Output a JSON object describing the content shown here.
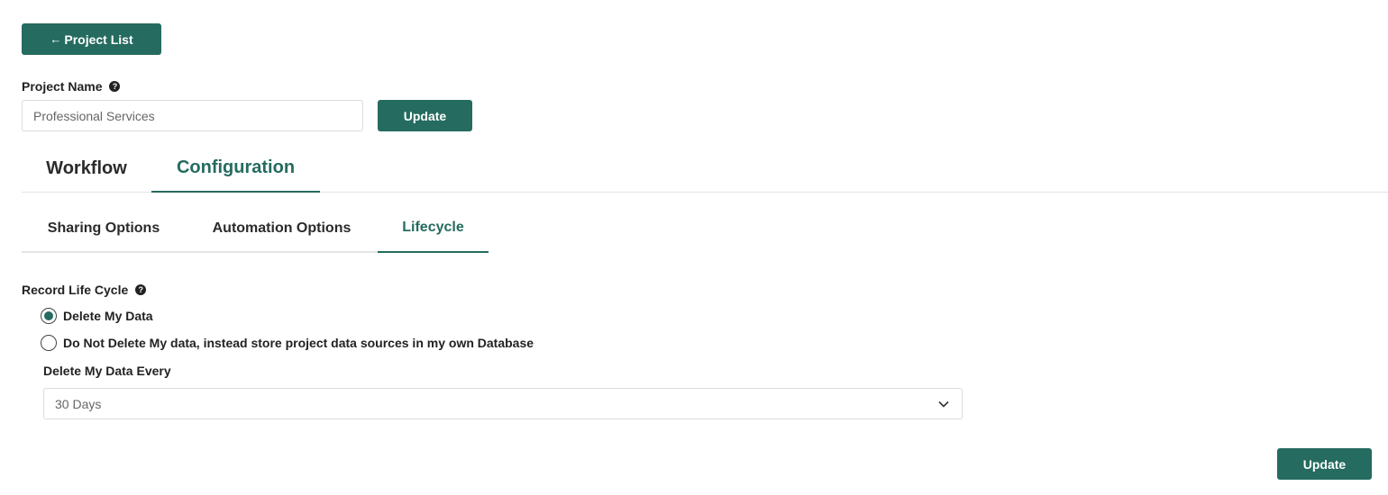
{
  "header": {
    "back_button_label": "Project List"
  },
  "project_name": {
    "label": "Project Name",
    "value": "Professional Services",
    "update_label": "Update"
  },
  "main_tabs": [
    {
      "label": "Workflow",
      "active": false
    },
    {
      "label": "Configuration",
      "active": true
    }
  ],
  "sub_tabs": [
    {
      "label": "Sharing Options",
      "active": false
    },
    {
      "label": "Automation Options",
      "active": false
    },
    {
      "label": "Lifecycle",
      "active": true
    }
  ],
  "lifecycle": {
    "label": "Record Life Cycle",
    "options": [
      {
        "label": "Delete My Data",
        "selected": true
      },
      {
        "label": "Do Not Delete My data, instead store project data sources in my own Database",
        "selected": false
      }
    ],
    "interval_label": "Delete My Data Every",
    "interval_value": "30 Days",
    "update_label": "Update"
  },
  "icons": {
    "back": "arrow-left-icon",
    "help": "question-circle-icon",
    "dropdown": "chevron-down-icon"
  },
  "colors": {
    "accent": "#256b5f",
    "text": "#222222",
    "border": "#dcdcdc"
  }
}
